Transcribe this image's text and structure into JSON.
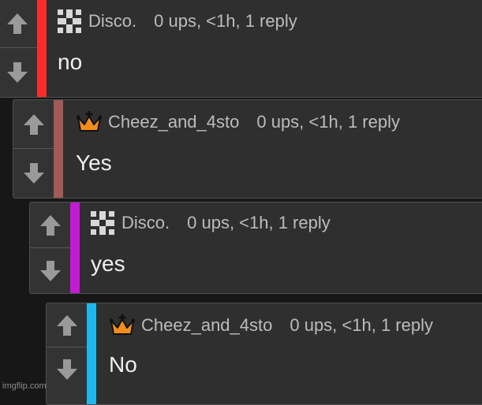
{
  "comments": [
    {
      "username": "Disco.",
      "meta": "0 ups, <1h, 1 reply",
      "text": "no",
      "badge": "disco-cross-icon",
      "color": "#ff2a2a"
    },
    {
      "username": "Cheez_and_4sto",
      "meta": "0 ups, <1h, 1 reply",
      "text": "Yes",
      "badge": "crown-icon",
      "color": "#a15a57"
    },
    {
      "username": "Disco.",
      "meta": "0 ups, <1h, 1 reply",
      "text": "yes",
      "badge": "disco-cross-icon",
      "color": "#c21bd3"
    },
    {
      "username": "Cheez_and_4sto",
      "meta": "0 ups, <1h, 1 reply",
      "text": "No",
      "badge": "crown-icon",
      "color": "#1fb8ee"
    }
  ],
  "watermark": "imgflip.com"
}
